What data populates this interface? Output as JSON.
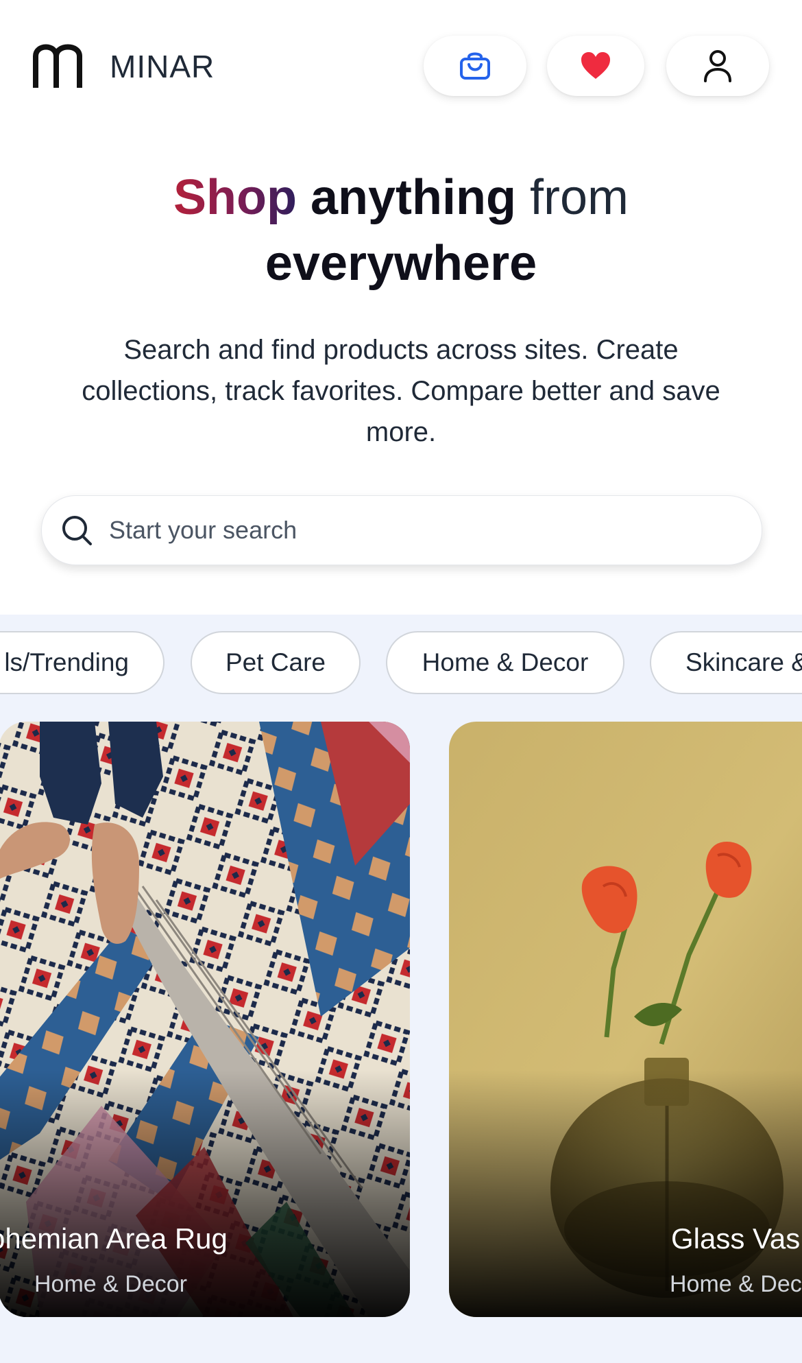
{
  "header": {
    "brand": "MINAR",
    "cart_icon": "shopping-bag-icon",
    "favorites_icon": "heart-icon",
    "profile_icon": "user-icon",
    "accent": "#2563eb",
    "heart_color": "#ef2b3f"
  },
  "hero": {
    "title_shop": "Shop",
    "title_anything": "anything",
    "title_from": "from",
    "title_everywhere": "everywhere",
    "subtitle": "Search and find products across sites. Create collections, track favorites. Compare better and save more."
  },
  "search": {
    "placeholder": "Start your search",
    "value": ""
  },
  "categories": [
    {
      "label": "ls/Trending"
    },
    {
      "label": "Pet Care"
    },
    {
      "label": "Home & Decor"
    },
    {
      "label": "Skincare &"
    }
  ],
  "products": [
    {
      "title": "ohemian Area Rug",
      "category": "Home & Decor"
    },
    {
      "title": "Glass Vas",
      "category": "Home & Dec"
    }
  ]
}
